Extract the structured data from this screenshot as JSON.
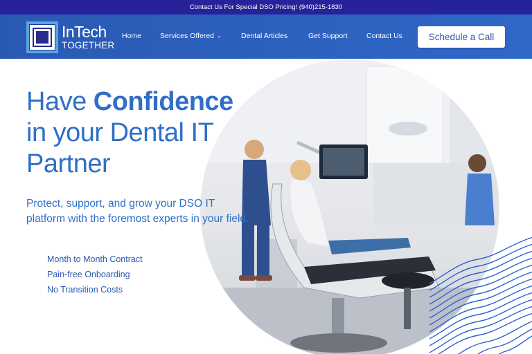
{
  "topbar": {
    "text": "Contact Us For Special DSO Pricing! (940)215-1830"
  },
  "logo": {
    "line1": "InTech",
    "line2": "TOGETHER"
  },
  "nav": {
    "items": [
      {
        "label": "Home"
      },
      {
        "label": "Services Offered",
        "icon": "chevron-down-icon"
      },
      {
        "label": "Dental Articles"
      },
      {
        "label": "Get Support"
      },
      {
        "label": "Contact Us"
      }
    ],
    "cta_label": "Schedule a Call"
  },
  "hero": {
    "headline_prefix": "Have ",
    "headline_bold": "Confidence",
    "headline_rest": "in your Dental IT Partner",
    "subtext": "Protect, support, and grow your DSO IT platform with the foremost experts in your field.",
    "features": [
      "Month to Month Contract",
      "Pain-free Onboarding",
      "No Transition Costs"
    ]
  },
  "colors": {
    "topbar": "#26229a",
    "navbar": "#2f68c8",
    "accent_text": "#2f6fc7",
    "waves": "#2a63cf"
  }
}
